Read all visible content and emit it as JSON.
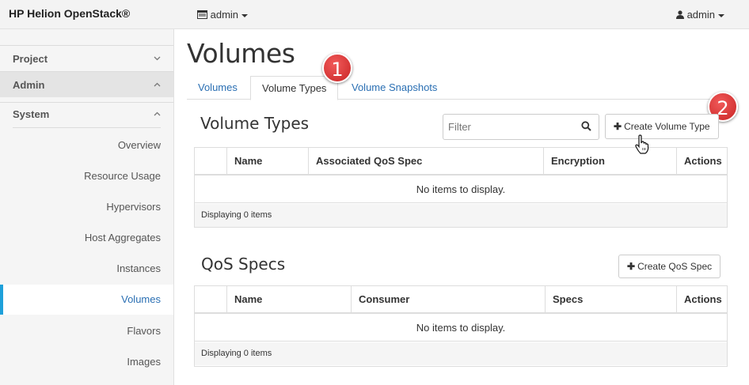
{
  "topbar": {
    "brand": "HP Helion OpenStack®",
    "project": "admin",
    "user": "admin"
  },
  "sidebar": {
    "sections": [
      {
        "label": "Project",
        "chevron": "chevron-down"
      },
      {
        "label": "Admin",
        "chevron": "chevron-up"
      },
      {
        "label": "System",
        "chevron": "chevron-up"
      }
    ],
    "items": [
      {
        "label": "Overview"
      },
      {
        "label": "Resource Usage"
      },
      {
        "label": "Hypervisors"
      },
      {
        "label": "Host Aggregates"
      },
      {
        "label": "Instances"
      },
      {
        "label": "Volumes",
        "active": true
      },
      {
        "label": "Flavors"
      },
      {
        "label": "Images"
      }
    ]
  },
  "page": {
    "title": "Volumes",
    "tabs": [
      {
        "label": "Volumes"
      },
      {
        "label": "Volume Types",
        "active": true
      },
      {
        "label": "Volume Snapshots"
      }
    ]
  },
  "callouts": [
    "1",
    "2"
  ],
  "volume_types": {
    "title": "Volume Types",
    "filter_placeholder": "Filter",
    "create_label": "Create Volume Type",
    "columns": [
      "Name",
      "Associated QoS Spec",
      "Encryption",
      "Actions"
    ],
    "empty_text": "No items to display.",
    "footer": "Displaying 0 items"
  },
  "qos_specs": {
    "title": "QoS Specs",
    "create_label": "Create QoS Spec",
    "columns": [
      "Name",
      "Consumer",
      "Specs",
      "Actions"
    ],
    "empty_text": "No items to display.",
    "footer": "Displaying 0 items"
  },
  "colors": {
    "link": "#2a6fb3",
    "active_bar": "#1ea0da",
    "callout": "#d32f2f"
  }
}
